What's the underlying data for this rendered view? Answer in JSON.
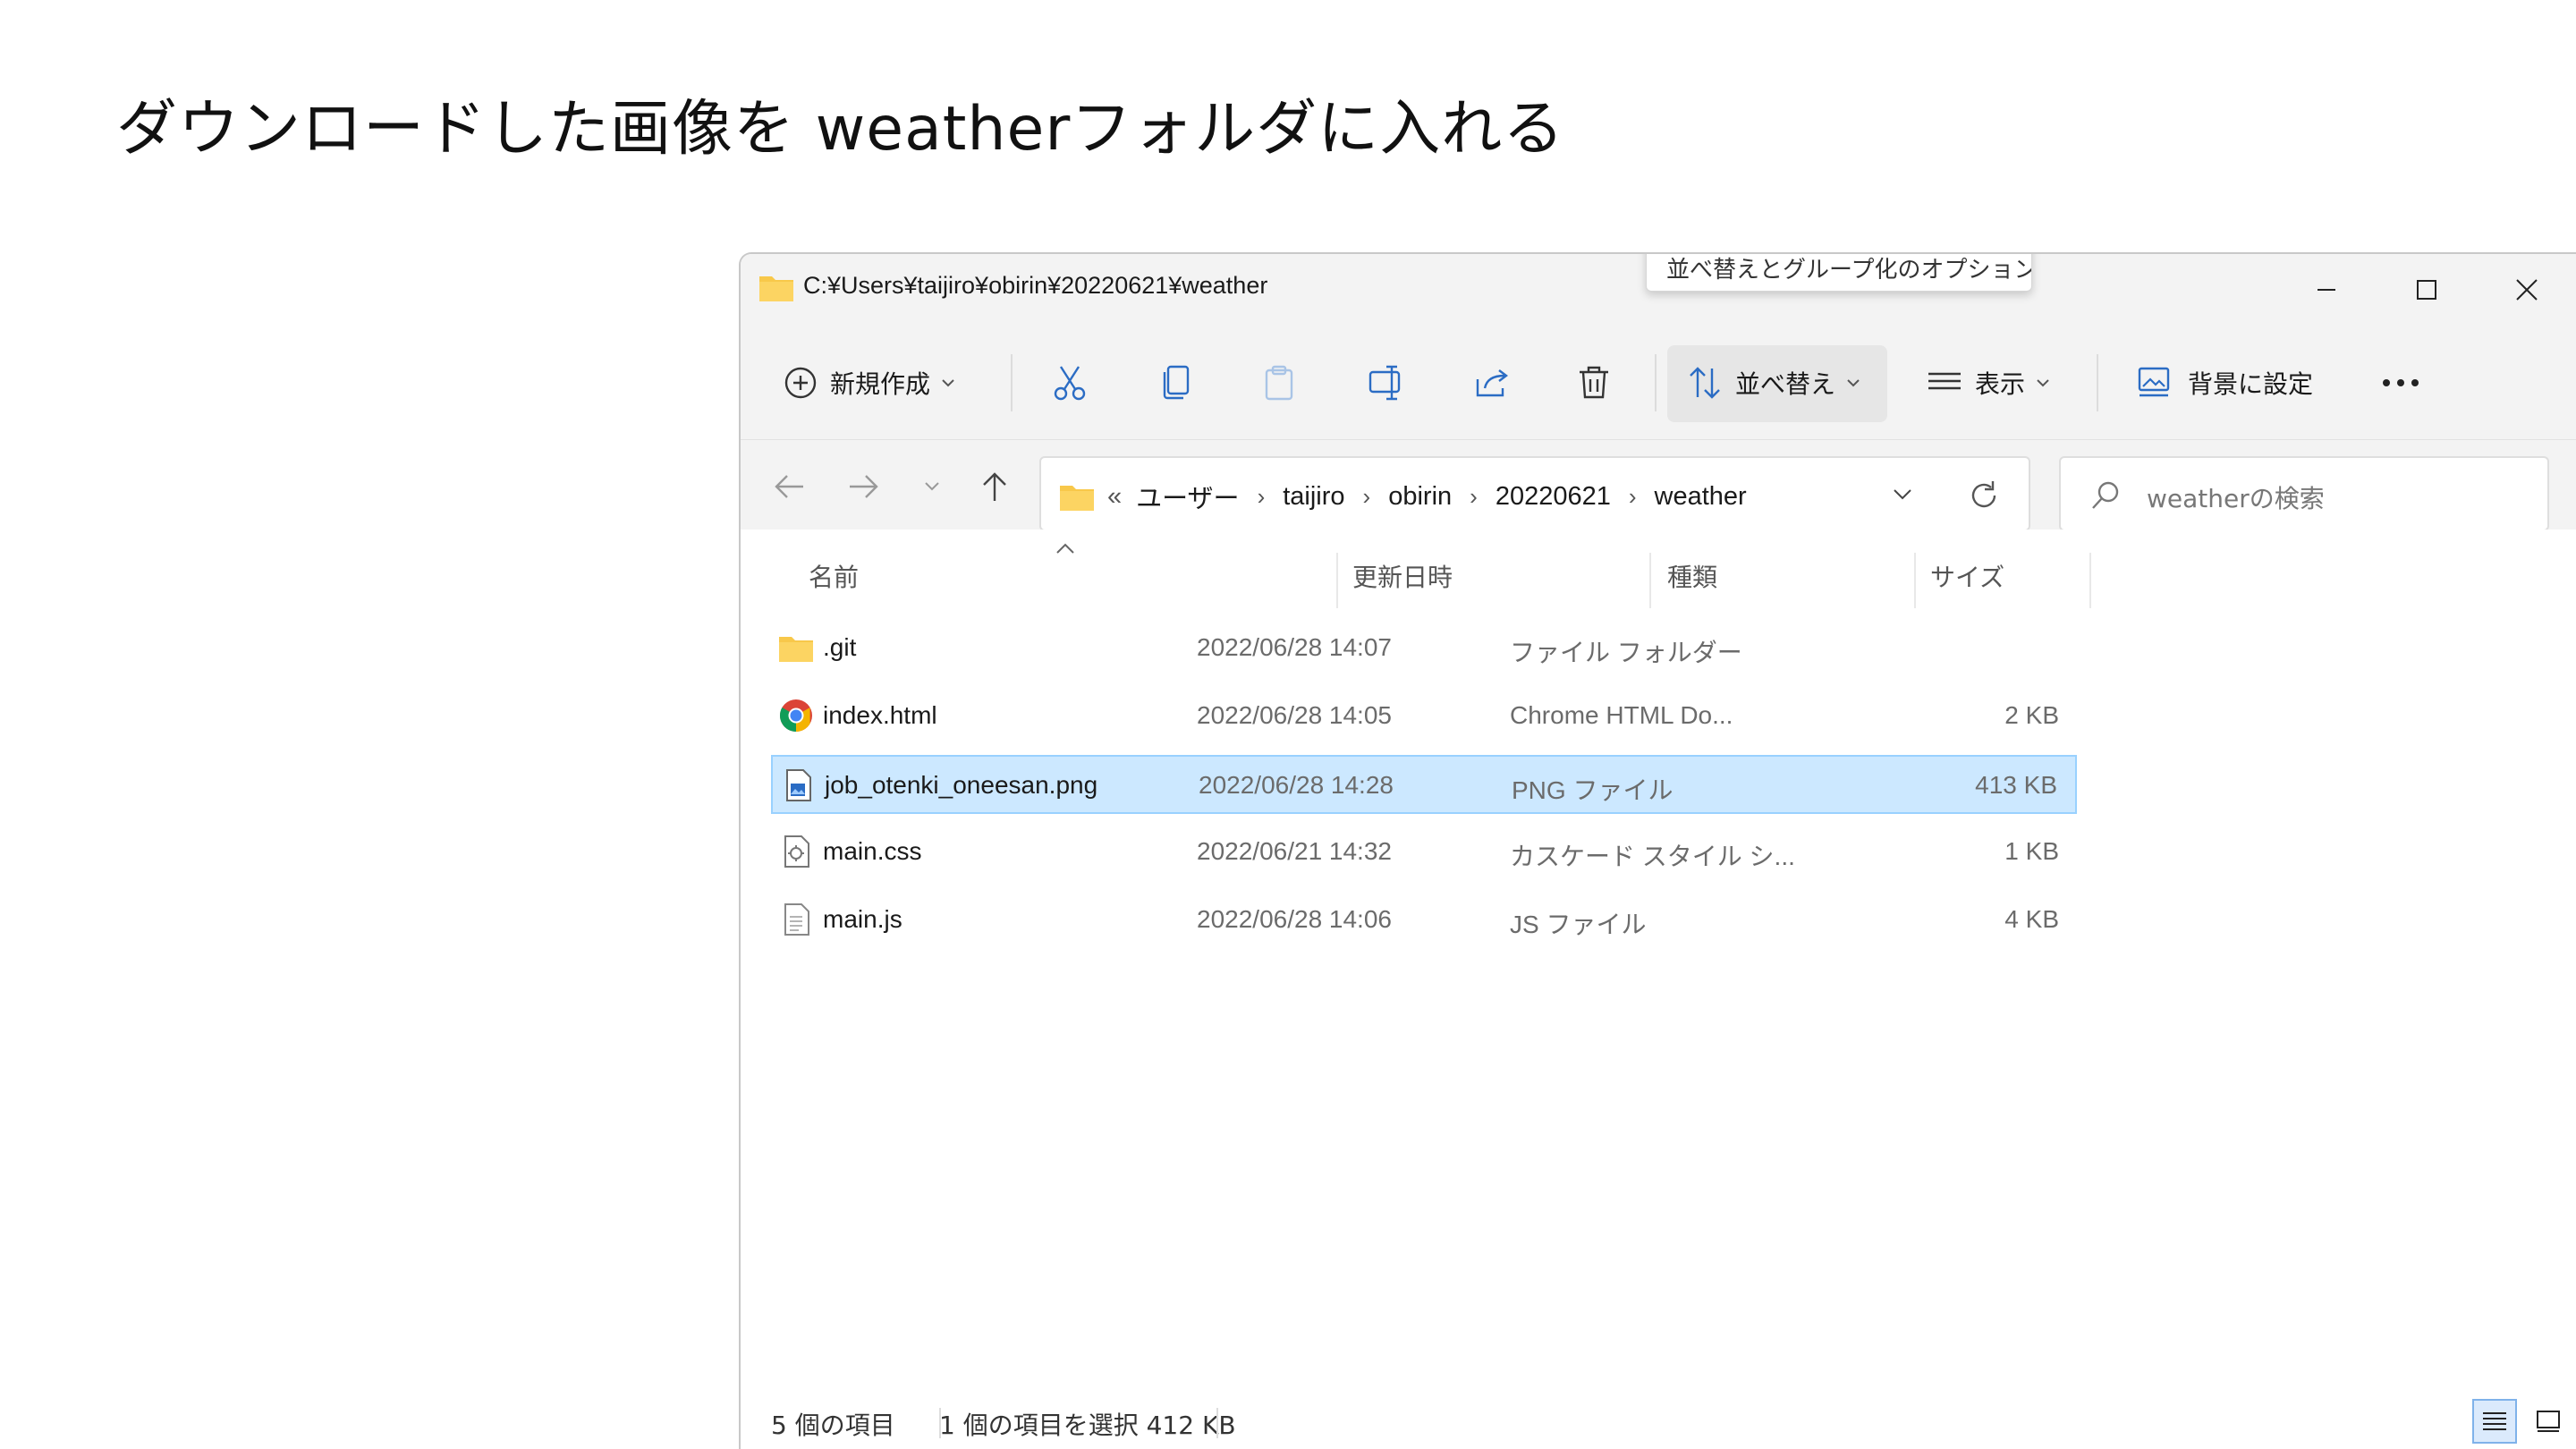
{
  "slide": {
    "title": "ダウンロードした画像を weatherフォルダに入れる"
  },
  "window": {
    "title_path": "C:¥Users¥taijiro¥obirin¥20220621¥weather",
    "tooltip": "並べ替えとグループ化のオプション。"
  },
  "toolbar": {
    "new_label": "新規作成",
    "sort_label": "並べ替え",
    "view_label": "表示",
    "background_label": "背景に設定"
  },
  "address": {
    "crumbs": [
      "ユーザー",
      "taijiro",
      "obirin",
      "20220621",
      "weather"
    ],
    "overflow": "«",
    "search_placeholder": "weatherの検索"
  },
  "columns": {
    "name": "名前",
    "date": "更新日時",
    "type": "種類",
    "size": "サイズ"
  },
  "files": [
    {
      "name": ".git",
      "date": "2022/06/28 14:07",
      "type": "ファイル フォルダー",
      "size": "",
      "icon": "folder-icon"
    },
    {
      "name": "index.html",
      "date": "2022/06/28 14:05",
      "type": "Chrome HTML Do...",
      "size": "2 KB",
      "icon": "chrome-icon"
    },
    {
      "name": "job_otenki_oneesan.png",
      "date": "2022/06/28 14:28",
      "type": "PNG ファイル",
      "size": "413 KB",
      "icon": "image-file-icon",
      "selected": true
    },
    {
      "name": "main.css",
      "date": "2022/06/21 14:32",
      "type": "カスケード スタイル シ...",
      "size": "1 KB",
      "icon": "css-file-icon"
    },
    {
      "name": "main.js",
      "date": "2022/06/28 14:06",
      "type": "JS ファイル",
      "size": "4 KB",
      "icon": "text-file-icon"
    }
  ],
  "status": {
    "item_count": "5 個の項目",
    "selection": "1 個の項目を選択  412 KB"
  },
  "colors": {
    "selection_bg": "#cce8ff",
    "selection_border": "#99d1ff",
    "folder": "#f8c84a",
    "chrome_red": "#db4437",
    "chrome_yellow": "#f4b400",
    "chrome_green": "#0f9d58",
    "chrome_blue": "#4285f4"
  }
}
